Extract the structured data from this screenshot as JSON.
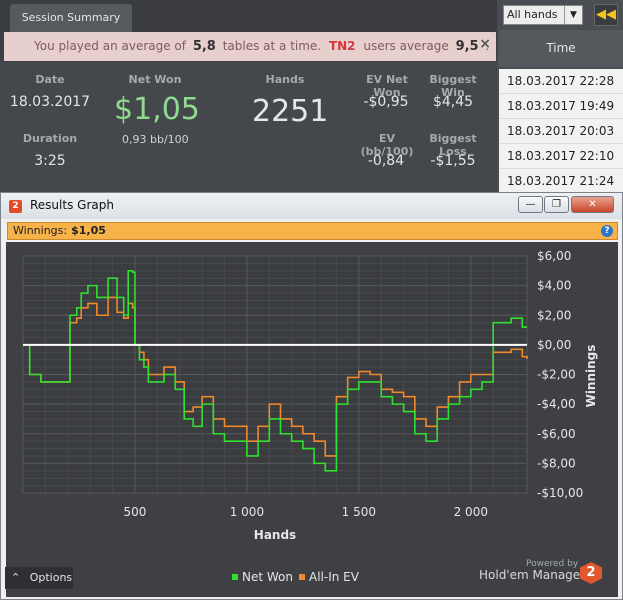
{
  "session_tab": "Session Summary",
  "banner": {
    "prefix": "You played an average of",
    "avg_tables": "5,8",
    "middle": "tables at a time.",
    "tag": "TN2",
    "suffix": "users average",
    "users_avg": "9,5",
    "end": ".",
    "close": "×"
  },
  "summary": {
    "date_label": "Date",
    "date_value": "18.03.2017",
    "duration_label": "Duration",
    "duration_value": "3:25",
    "netwon_label": "Net Won",
    "netwon_value": "$1,05",
    "netwon_sub": "0,93 bb/100",
    "hands_label": "Hands",
    "hands_value": "2251",
    "ev_label": "EV Net Won",
    "ev_value": "-$0,95",
    "bigwin_label": "Biggest Win",
    "bigwin_value": "$4,45",
    "evbb_label": "EV (bb/100)",
    "evbb_value": "-0,84",
    "bigloss_label": "Biggest Loss",
    "bigloss_value": "-$1,55"
  },
  "right_panel": {
    "filter": "All hands",
    "time_header": "Time",
    "times": [
      "18.03.2017 22:28",
      "18.03.2017 19:49",
      "18.03.2017 20:03",
      "18.03.2017 22:10",
      "18.03.2017 21:24"
    ]
  },
  "window": {
    "title": "Results Graph",
    "minimize": "—",
    "restore": "❐",
    "close": "✕",
    "winnings_label": "Winnings:",
    "winnings_value": "$1,05",
    "help": "?",
    "options": "Options",
    "powered": "Powered by",
    "brand": "Hold'em Manager",
    "brand_mark": "2"
  },
  "colors": {
    "net_won": "#2fe02f",
    "all_in_ev": "#f0892c",
    "zero_line": "#ffffff"
  },
  "chart_data": {
    "type": "line",
    "xlabel": "Hands",
    "ylabel": "Winnings",
    "xlim": [
      0,
      2251
    ],
    "ylim": [
      -10,
      6
    ],
    "x_ticks": [
      500,
      1000,
      1500,
      2000
    ],
    "x_tick_labels": [
      "500",
      "1 000",
      "1 500",
      "2 000"
    ],
    "y_ticks": [
      6,
      4,
      2,
      0,
      -2,
      -4,
      -6,
      -8,
      -10
    ],
    "y_tick_labels": [
      "$6,00",
      "$4,00",
      "$2,00",
      "$0,00",
      "-$2,00",
      "-$4,00",
      "-$6,00",
      "-$8,00",
      "-$10,00"
    ],
    "grid": true,
    "legend_position": "bottom-center",
    "x": [
      0,
      30,
      80,
      130,
      170,
      210,
      240,
      260,
      290,
      330,
      380,
      420,
      450,
      470,
      490,
      500,
      520,
      540,
      560,
      590,
      630,
      680,
      720,
      760,
      800,
      850,
      900,
      960,
      1000,
      1050,
      1100,
      1150,
      1200,
      1250,
      1300,
      1350,
      1400,
      1450,
      1500,
      1550,
      1600,
      1650,
      1700,
      1750,
      1800,
      1850,
      1900,
      1950,
      2000,
      2050,
      2080,
      2100,
      2130,
      2180,
      2230,
      2251
    ],
    "series": [
      {
        "name": "Net Won",
        "values": [
          0,
          -2,
          -2.5,
          -2.5,
          -2.5,
          2,
          2.5,
          3.5,
          4,
          3.2,
          4.5,
          3.2,
          2,
          5,
          4.9,
          0,
          -1,
          -1.5,
          -2.5,
          -2.5,
          -2,
          -3,
          -5,
          -5.5,
          -4,
          -6,
          -6.5,
          -6.5,
          -7.5,
          -6.5,
          -5,
          -6,
          -6.5,
          -7,
          -8,
          -8.5,
          -4,
          -3,
          -2.5,
          -2.5,
          -3.5,
          -4,
          -4.5,
          -6,
          -6.5,
          -5,
          -4,
          -3.5,
          -3,
          -2.5,
          -2.5,
          1.5,
          1.5,
          1.8,
          1.2,
          1.2
        ]
      },
      {
        "name": "All-In EV",
        "values": [
          0,
          -2,
          -2.5,
          -2.5,
          -2.5,
          1.5,
          1.8,
          2.5,
          2.8,
          2,
          3.2,
          2.2,
          1.8,
          2.8,
          2.5,
          0,
          -0.5,
          -1,
          -2,
          -2,
          -1.5,
          -2.5,
          -4.5,
          -4.2,
          -3.5,
          -5,
          -5.5,
          -5.5,
          -6.5,
          -5.5,
          -4,
          -5,
          -5.5,
          -6,
          -6.5,
          -7.5,
          -3.5,
          -2.2,
          -1.8,
          -2,
          -3,
          -3.2,
          -3.5,
          -5,
          -5.5,
          -4.2,
          -3.5,
          -2.5,
          -2,
          -2,
          -2,
          -0.5,
          -0.5,
          -0.3,
          -0.8,
          -0.95
        ]
      }
    ]
  }
}
